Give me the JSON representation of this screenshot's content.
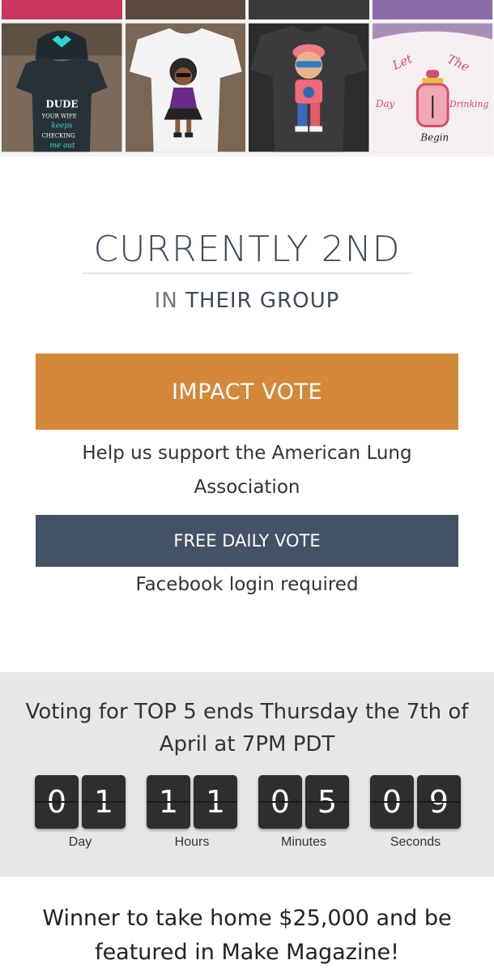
{
  "rank": {
    "title": "CURRENTLY 2ND",
    "prefix": "IN",
    "group": "THEIR GROUP"
  },
  "impact_vote": {
    "label": "IMPACT VOTE",
    "note": "Help us support the American Lung Association",
    "color": "#d4883a"
  },
  "free_vote": {
    "label": "FREE DAILY VOTE",
    "note": "Facebook login required",
    "color": "#435266"
  },
  "countdown": {
    "headline": "Voting for TOP 5 ends Thursday the 7th of April at 7PM PDT",
    "units": [
      {
        "digits": [
          "0",
          "1"
        ],
        "label": "Day"
      },
      {
        "digits": [
          "1",
          "1"
        ],
        "label": "Hours"
      },
      {
        "digits": [
          "0",
          "5"
        ],
        "label": "Minutes"
      },
      {
        "digits": [
          "0",
          "9"
        ],
        "label": "Seconds"
      }
    ]
  },
  "prize": {
    "text": "Winner to take home $25,000 and be featured in Make Magazine!"
  },
  "gallery": {
    "photos": [
      {
        "icon": "dark-onesie-photo",
        "art_text": [
          "DUDE",
          "YOUR WIFE",
          "keeps",
          "CHECKING",
          "me out"
        ]
      },
      {
        "icon": "white-onesie-doll-photo"
      },
      {
        "icon": "grey-onesie-boy-photo"
      },
      {
        "icon": "pink-bottle-onesie-photo",
        "art_text": [
          "Let",
          "The",
          "Day",
          "Drinking",
          "Begin"
        ]
      }
    ]
  }
}
